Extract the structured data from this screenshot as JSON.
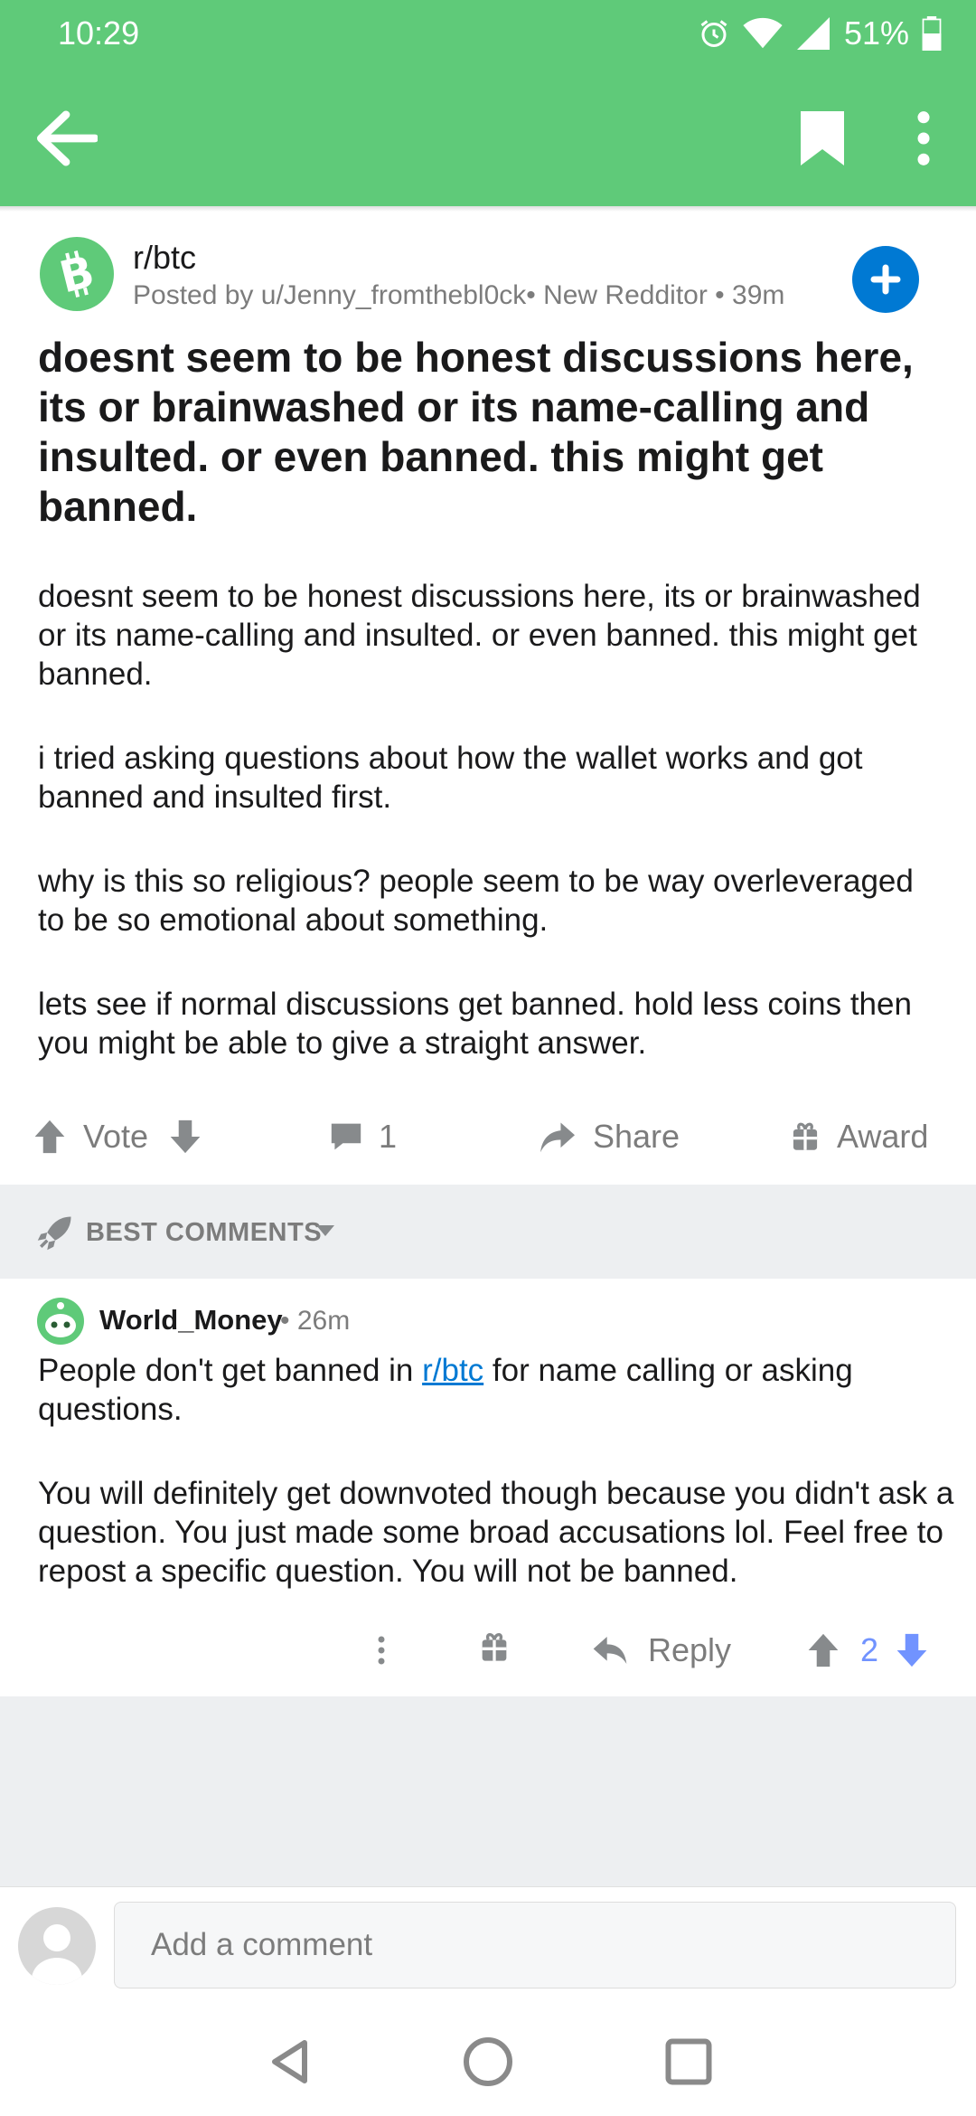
{
  "status_bar": {
    "time": "10:29",
    "battery": "51%"
  },
  "post": {
    "subreddit": "r/btc",
    "meta": "Posted by u/Jenny_fromthebl0ck• New Redditor • 39m",
    "title": "doesnt seem to be honest discussions here, its or brainwashed or its name-calling and insulted. or even banned. this might get banned.",
    "body": [
      "doesnt seem to be honest discussions here, its or brainwashed or its name-calling and insulted. or even banned. this might get banned.",
      "i tried asking questions about how the wallet works and got banned and insulted first.",
      "why is this so religious? people seem to be way overleveraged to be so emotional about something.",
      "lets see if normal discussions get banned. hold less coins then you might be able to give a straight answer."
    ],
    "actions": {
      "vote": "Vote",
      "comments": "1",
      "share": "Share",
      "award": "Award"
    }
  },
  "sort": {
    "label": "BEST COMMENTS"
  },
  "comment": {
    "author": "World_Money",
    "time": "• 26m",
    "p1_before": "People don't get banned in ",
    "p1_link": "r/btc",
    "p1_after": " for name calling or asking questions.",
    "p2": "You will definitely get downvoted though because you didn't ask a question. You just made some broad accusations lol. Feel free to repost a specific question. You will not be banned.",
    "reply": "Reply",
    "score": "2"
  },
  "compose": {
    "placeholder": "Add a comment"
  },
  "colors": {
    "brand": "#5fca79",
    "accent": "#0079d3",
    "upvoted": "#7193ff"
  },
  "icons": [
    "alarm-icon",
    "wifi-icon",
    "signal-icon",
    "battery-icon",
    "back-arrow-icon",
    "bookmark-icon",
    "more-vert-icon",
    "bitcoin-cash-icon",
    "plus-icon",
    "upvote-icon",
    "downvote-icon",
    "comment-icon",
    "share-icon",
    "award-icon",
    "rocket-icon",
    "chevron-down-icon",
    "avatar-icon",
    "nav-back-icon",
    "nav-home-icon",
    "nav-recents-icon"
  ]
}
